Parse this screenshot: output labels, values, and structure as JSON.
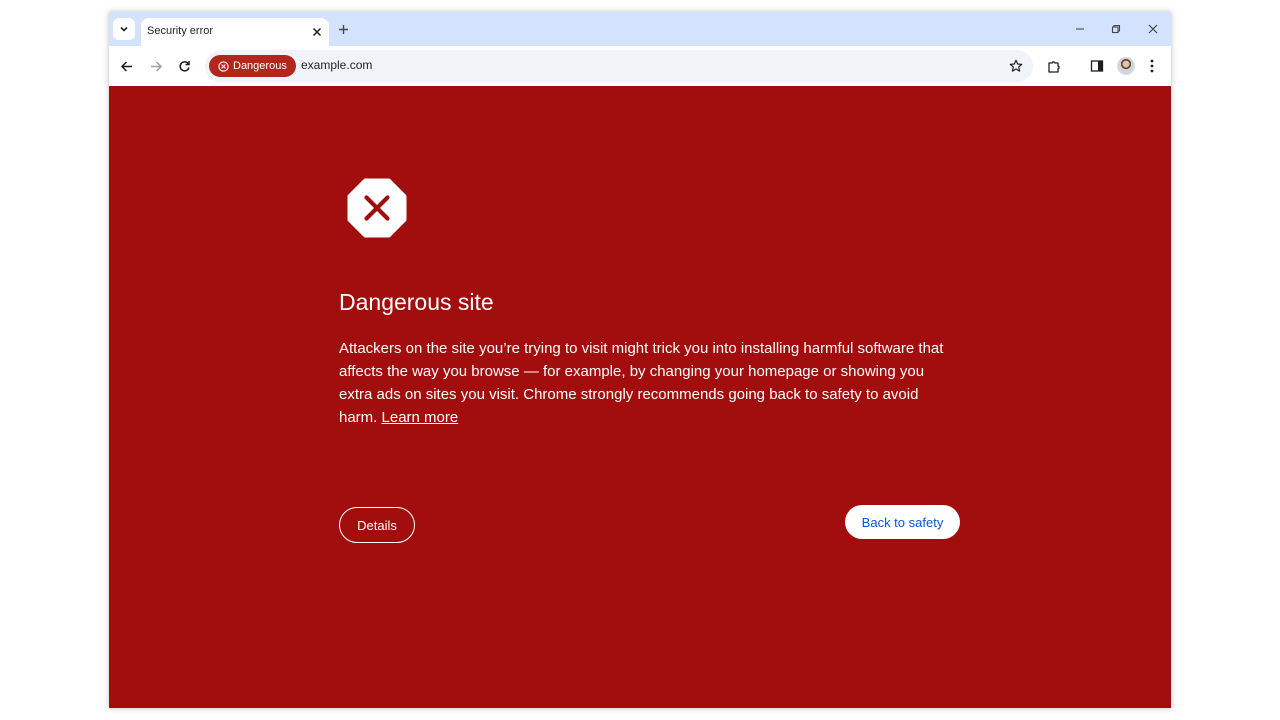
{
  "tabstrip": {
    "search_icon": "chevron-down-icon",
    "tab": {
      "title": "Security error",
      "close_icon": "close-icon"
    },
    "new_tab_icon": "plus-icon",
    "window_controls": [
      "minimize-icon",
      "restore-icon",
      "close-icon"
    ]
  },
  "toolbar": {
    "back_icon": "back-arrow-icon",
    "forward_icon": "forward-arrow-icon",
    "reload_icon": "reload-icon",
    "security_chip": {
      "label": "Dangerous",
      "icon": "error-circle-icon"
    },
    "url": "example.com",
    "bookmark_icon": "star-icon",
    "extensions_icon": "puzzle-icon",
    "side_panel_icon": "side-panel-icon",
    "profile": "avatar",
    "menu_icon": "kebab-menu-icon"
  },
  "interstitial": {
    "icon": "stop-octagon-icon",
    "title": "Dangerous site",
    "body": "Attackers on the site you’re trying to visit might trick you into installing harmful software that affects the way you browse — for example, by changing your homepage or showing you extra ads on sites you visit. Chrome strongly recommends going back to safety to avoid harm.",
    "learn_more": "Learn more",
    "details_button": "Details",
    "back_to_safety_button": "Back to safety"
  },
  "colors": {
    "background_danger": "#a10e0d",
    "chip_danger": "#b3261e",
    "tabstrip": "#d3e3fd",
    "link_blue": "#0b57d0"
  }
}
